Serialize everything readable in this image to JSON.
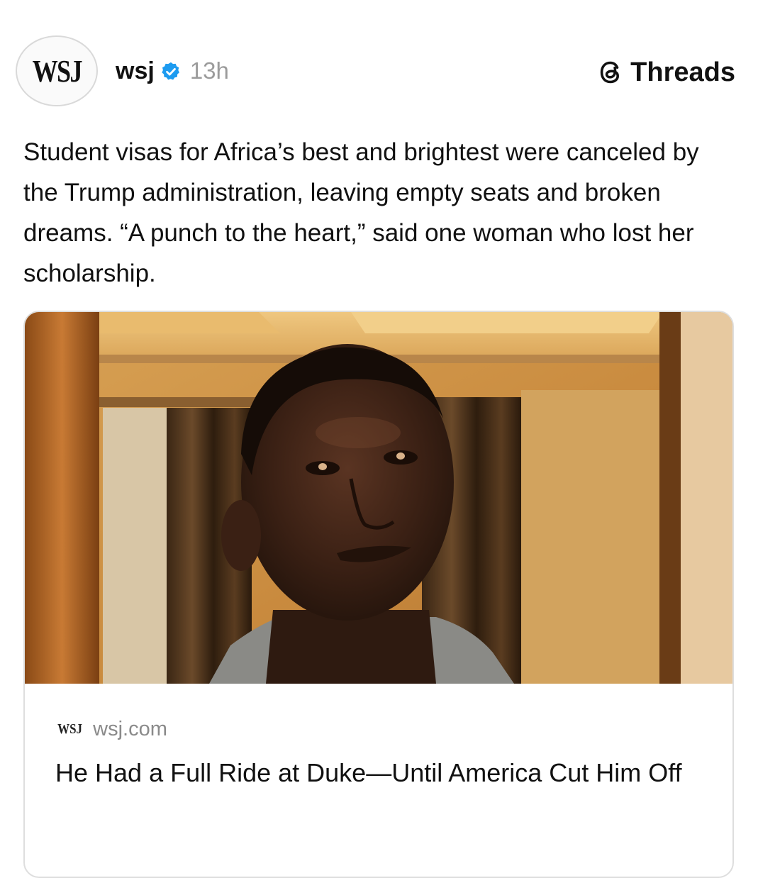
{
  "post": {
    "avatar_text": "WSJ",
    "author": "wsj",
    "verified": true,
    "time": "13h",
    "platform": "Threads",
    "caption": "Student visas for Africa’s best and brightest were canceled by the Trump administration, leaving empty seats and broken dreams. “A punch to the heart,” said one woman who lost her scholarship."
  },
  "card": {
    "image_icon": "photo-of-young-man",
    "source_logo": "WSJ",
    "domain": "wsj.com",
    "title": "He Had a Full Ride at Duke—Until America Cut Him Off"
  },
  "colors": {
    "verified_blue": "#1d9bf0",
    "muted_text": "#9b9b9b",
    "card_border": "#dedede"
  }
}
